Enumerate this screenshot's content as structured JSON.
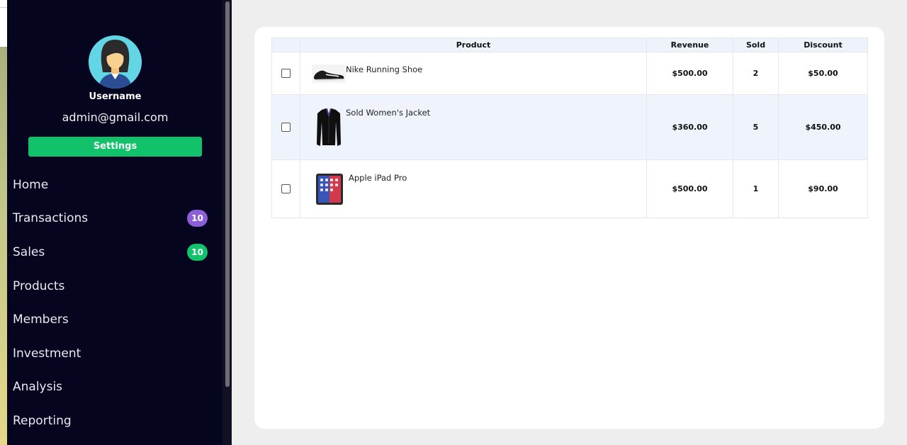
{
  "sidebar": {
    "username": "Username",
    "email": "admin@gmail.com",
    "settings_label": "Settings",
    "items": [
      {
        "label": "Home"
      },
      {
        "label": "Transactions",
        "badge": "10",
        "badge_color": "#8c5fd8"
      },
      {
        "label": "Sales",
        "badge": "10",
        "badge_color": "#11c26a"
      },
      {
        "label": "Products"
      },
      {
        "label": "Members"
      },
      {
        "label": "Investment"
      },
      {
        "label": "Analysis"
      },
      {
        "label": "Reporting"
      }
    ]
  },
  "table": {
    "headers": {
      "product": "Product",
      "revenue": "Revenue",
      "sold": "Sold",
      "discount": "Discount"
    },
    "rows": [
      {
        "product": "Nike Running Shoe",
        "image": "shoe-image",
        "revenue": "$500.00",
        "sold": "2",
        "discount": "$50.00"
      },
      {
        "product": "Sold Women's Jacket",
        "image": "jacket-image",
        "revenue": "$360.00",
        "sold": "5",
        "discount": "$450.00"
      },
      {
        "product": "Apple iPad Pro",
        "image": "ipad-image",
        "revenue": "$500.00",
        "sold": "1",
        "discount": "$90.00"
      }
    ]
  },
  "colors": {
    "sidebar_bg": "#06051f",
    "accent_green": "#11c26a",
    "accent_purple": "#8c5fd8",
    "page_bg": "#eeeeee"
  }
}
